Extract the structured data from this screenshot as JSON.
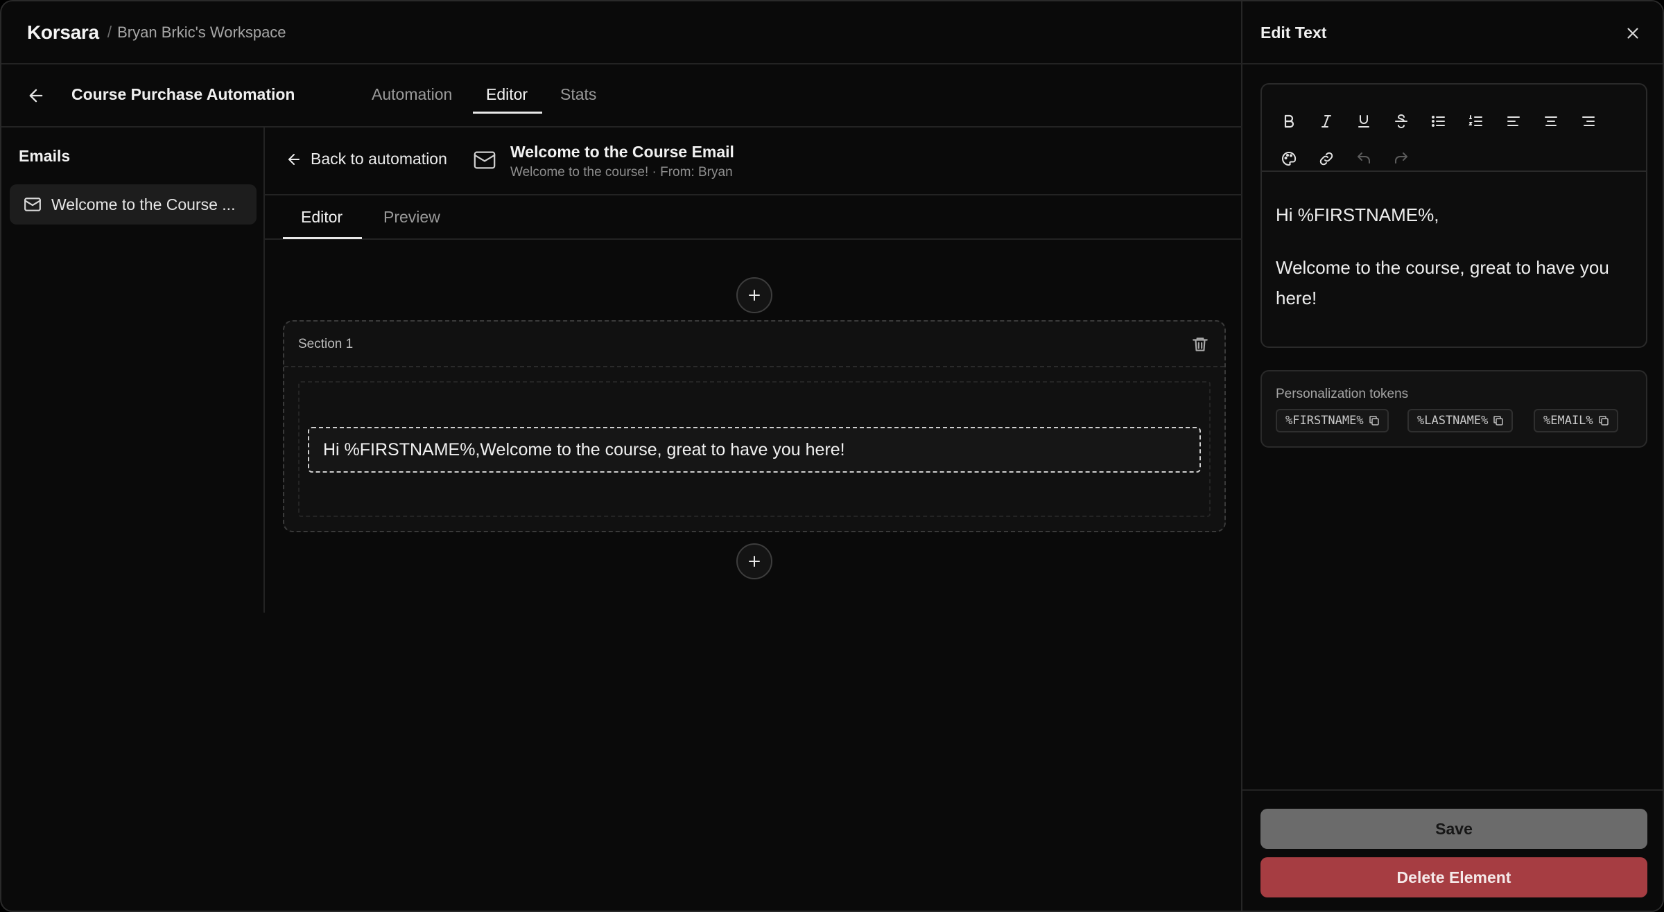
{
  "topbar": {
    "brand": "Korsara",
    "separator": "/",
    "workspace": "Bryan Brkic's Workspace"
  },
  "subbar": {
    "automation_title": "Course Purchase Automation",
    "tabs": [
      {
        "label": "Automation",
        "active": false
      },
      {
        "label": "Editor",
        "active": true
      },
      {
        "label": "Stats",
        "active": false
      }
    ]
  },
  "emails_sidebar": {
    "heading": "Emails",
    "items": [
      {
        "label": "Welcome to the Course ...",
        "icon": "mail-icon"
      }
    ]
  },
  "email_header": {
    "back_label": "Back to automation",
    "title": "Welcome to the Course Email",
    "subtitle": "Welcome to the course! · From: Bryan"
  },
  "editor_tabs": [
    {
      "label": "Editor",
      "active": true
    },
    {
      "label": "Preview",
      "active": false
    }
  ],
  "canvas": {
    "section_label": "Section 1",
    "text_block": "Hi %FIRSTNAME%,Welcome to the course, great to have you here!"
  },
  "panel": {
    "title": "Edit Text",
    "toolbar": [
      "bold-icon",
      "italic-icon",
      "underline-icon",
      "strikethrough-icon",
      "bullet-list-icon",
      "numbered-list-icon",
      "align-left-icon",
      "align-center-icon",
      "align-right-icon",
      "palette-icon",
      "link-icon",
      "undo-icon",
      "redo-icon"
    ],
    "body_lines": [
      "Hi %FIRSTNAME%,",
      "Welcome to the course, great to have you here!"
    ],
    "tokens_label": "Personalization tokens",
    "tokens": [
      "%FIRSTNAME%",
      "%LASTNAME%",
      "%EMAIL%"
    ],
    "save_label": "Save",
    "delete_label": "Delete Element"
  },
  "colors": {
    "background": "#0a0a0a",
    "delete_button": "#a63d42",
    "save_button": "#6b6b6b"
  }
}
